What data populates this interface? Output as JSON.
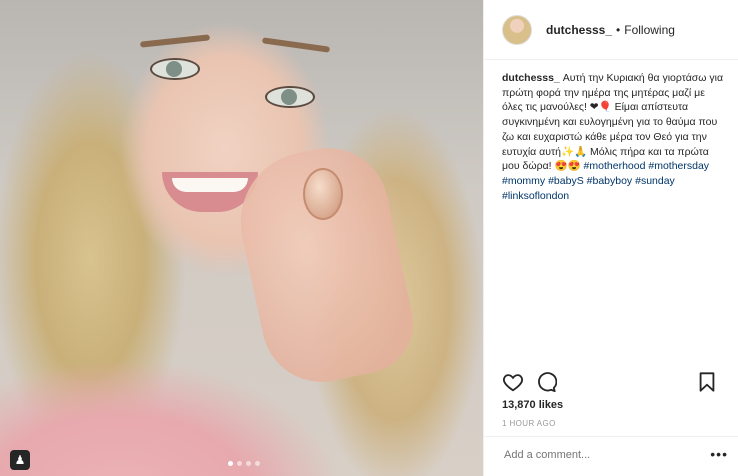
{
  "header": {
    "username": "dutchesss_",
    "separator": "•",
    "follow_status": "Following"
  },
  "caption": {
    "username": "dutchesss_",
    "text_1": "Αυτή την Κυριακή θα γιορτάσω για πρώτη φορά την ημέρα της μητέρας μαζί με όλες τις μανούλες! ❤🎈 Είμαι απίστευτα συγκινημένη και ευλογημένη για το θαύμα που ζω και ευχαριστώ κάθε μέρα τον Θεό για την ευτυχία αυτή✨🙏 Μόλις πήρα και τα πρώτα μου δώρα! 😍😍",
    "hashtags": [
      "#motherhood",
      "#mothersday",
      "#mommy",
      "#babyS",
      "#babyboy",
      "#sunday",
      "#linksoflondon"
    ]
  },
  "actions": {
    "like_icon": "heart-icon",
    "comment_icon": "comment-icon",
    "save_icon": "bookmark-icon"
  },
  "likes": "13,870 likes",
  "timestamp": "1 HOUR AGO",
  "comment": {
    "placeholder": "Add a comment...",
    "more_label": "•••"
  },
  "media": {
    "carousel_dots": 4,
    "active_dot": 1
  }
}
